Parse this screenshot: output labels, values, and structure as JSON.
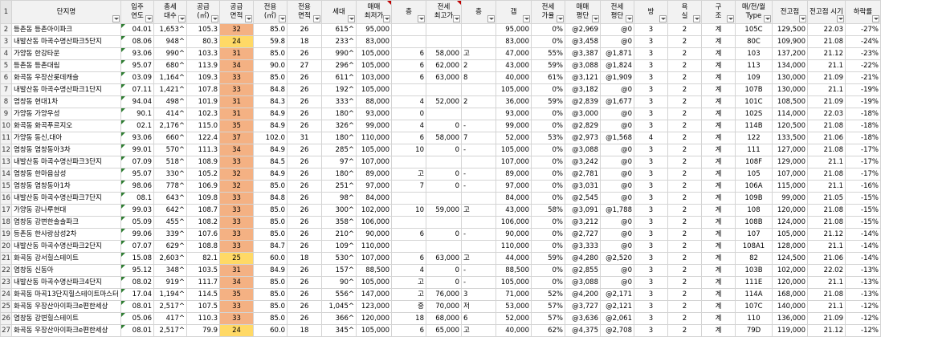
{
  "row_numbers": [
    "1",
    "2",
    "3",
    "4",
    "5",
    "6",
    "7",
    "8",
    "9",
    "10",
    "11",
    "12",
    "13",
    "14",
    "15",
    "16",
    "17",
    "18",
    "19",
    "20",
    "21",
    "22",
    "23",
    "24",
    "25",
    "26",
    "27"
  ],
  "headers": [
    "단지명",
    "입주\n연도",
    "총세\n대수",
    "공급\n(㎡)",
    "공급\n면적",
    "전용\n(㎡)",
    "전용\n면적",
    "세대",
    "매매\n최저가",
    "층",
    "전세\n최고가",
    "층",
    "갭",
    "전세\n가율",
    "매매\n평단",
    "전세\n평단",
    "방",
    "욕\n실",
    "구\n조",
    "매/전/월\nType",
    "전고점",
    "전고점 시기",
    "하락률"
  ],
  "rows": [
    [
      "등촌동 등촌아이파크",
      "04.01",
      "1,653^",
      "105.3",
      "32",
      "85.0",
      "26",
      "615^",
      "95,000",
      "",
      "",
      "",
      "95,000",
      "0%",
      "@2,969",
      "@0",
      "3",
      "2",
      "계",
      "105C",
      "129,500",
      "22.03",
      "-27%"
    ],
    [
      "내발산동 마곡수명산파크5단지",
      "08.06",
      "948^",
      "80.3",
      "24",
      "59.8",
      "18",
      "233^",
      "83,000",
      "",
      "",
      "",
      "83,000",
      "0%",
      "@3,458",
      "@0",
      "3",
      "2",
      "계",
      "80C",
      "109,900",
      "21.08",
      "-24%"
    ],
    [
      "가양동 한강타운",
      "93.06",
      "990^",
      "103.3",
      "31",
      "85.0",
      "26",
      "990^",
      "105,000",
      "6",
      "58,000",
      "고",
      "47,000",
      "55%",
      "@3,387",
      "@1,871",
      "3",
      "2",
      "계",
      "103",
      "137,200",
      "21.12",
      "-23%"
    ],
    [
      "등촌동 등촌대림",
      "95.07",
      "680^",
      "113.9",
      "34",
      "90.0",
      "27",
      "296^",
      "105,000",
      "6",
      "62,000",
      "2",
      "43,000",
      "59%",
      "@3,088",
      "@1,824",
      "3",
      "2",
      "계",
      "113",
      "134,000",
      "21.1",
      "-22%"
    ],
    [
      "화곡동 우장산롯데캐슬",
      "03.09",
      "1,164^",
      "109.3",
      "33",
      "85.0",
      "26",
      "611^",
      "103,000",
      "6",
      "63,000",
      "8",
      "40,000",
      "61%",
      "@3,121",
      "@1,909",
      "3",
      "2",
      "계",
      "109",
      "130,000",
      "21.09",
      "-21%"
    ],
    [
      "내발산동 마곡수명산파크1단지",
      "07.11",
      "1,421^",
      "107.8",
      "33",
      "84.8",
      "26",
      "192^",
      "105,000",
      "",
      "",
      "",
      "105,000",
      "0%",
      "@3,182",
      "@0",
      "3",
      "2",
      "계",
      "107B",
      "130,000",
      "21.1",
      "-19%"
    ],
    [
      "염창동 현대1차",
      "94.04",
      "498^",
      "101.9",
      "31",
      "84.3",
      "26",
      "333^",
      "88,000",
      "4",
      "52,000",
      "2",
      "36,000",
      "59%",
      "@2,839",
      "@1,677",
      "3",
      "2",
      "계",
      "101C",
      "108,500",
      "21.09",
      "-19%"
    ],
    [
      "가양동 가양우성",
      "90.1",
      "414^",
      "102.3",
      "31",
      "84.9",
      "26",
      "180^",
      "93,000",
      "0",
      "",
      "",
      "93,000",
      "0%",
      "@3,000",
      "@0",
      "3",
      "2",
      "계",
      "102S",
      "114,000",
      "22.03",
      "-18%"
    ],
    [
      "화곡동 화곡푸르지오",
      "02.1",
      "2,176^",
      "115.0",
      "35",
      "84.9",
      "26",
      "326^",
      "99,000",
      "4",
      "0",
      "-",
      "99,000",
      "0%",
      "@2,829",
      "@0",
      "3",
      "2",
      "계",
      "114B",
      "120,500",
      "21.08",
      "-18%"
    ],
    [
      "가양동 동신,대아",
      "93.06",
      "660^",
      "122.4",
      "37",
      "102.0",
      "31",
      "180^",
      "110,000",
      "6",
      "58,000",
      "7",
      "52,000",
      "53%",
      "@2,973",
      "@1,568",
      "4",
      "2",
      "계",
      "122",
      "133,500",
      "21.06",
      "-18%"
    ],
    [
      "염창동 염창동아3차",
      "99.01",
      "570^",
      "111.3",
      "34",
      "84.9",
      "26",
      "285^",
      "105,000",
      "10",
      "0",
      "-",
      "105,000",
      "0%",
      "@3,088",
      "@0",
      "3",
      "2",
      "계",
      "111",
      "127,000",
      "21.08",
      "-17%"
    ],
    [
      "내발산동 마곡수명산파크3단지",
      "07.09",
      "518^",
      "108.9",
      "33",
      "84.5",
      "26",
      "97^",
      "107,000",
      "",
      "",
      "",
      "107,000",
      "0%",
      "@3,242",
      "@0",
      "3",
      "2",
      "계",
      "108F",
      "129,000",
      "21.1",
      "-17%"
    ],
    [
      "염창동 한마음삼성",
      "95.07",
      "330^",
      "105.2",
      "32",
      "84.9",
      "26",
      "180^",
      "89,000",
      "고",
      "0",
      "-",
      "89,000",
      "0%",
      "@2,781",
      "@0",
      "3",
      "2",
      "계",
      "105",
      "107,000",
      "21.08",
      "-17%"
    ],
    [
      "염창동 염창동아1차",
      "98.06",
      "778^",
      "106.9",
      "32",
      "85.0",
      "26",
      "251^",
      "97,000",
      "7",
      "0",
      "-",
      "97,000",
      "0%",
      "@3,031",
      "@0",
      "3",
      "2",
      "계",
      "106A",
      "115,000",
      "21.1",
      "-16%"
    ],
    [
      "내발산동 마곡수명산파크7단지",
      "08.1",
      "643^",
      "109.8",
      "33",
      "84.8",
      "26",
      "98^",
      "84,000",
      "",
      "",
      "",
      "84,000",
      "0%",
      "@2,545",
      "@0",
      "3",
      "2",
      "계",
      "109B",
      "99,000",
      "21.05",
      "-15%"
    ],
    [
      "가양동 강나루현대",
      "99.03",
      "642^",
      "108.7",
      "33",
      "85.0",
      "26",
      "300^",
      "102,000",
      "10",
      "59,000",
      "고",
      "43,000",
      "58%",
      "@3,091",
      "@1,788",
      "3",
      "2",
      "계",
      "108",
      "120,000",
      "21.08",
      "-15%"
    ],
    [
      "염창동 강변한솔솔파크",
      "05.09",
      "455^",
      "108.2",
      "33",
      "85.0",
      "26",
      "358^",
      "106,000",
      "",
      "",
      "",
      "106,000",
      "0%",
      "@3,212",
      "@0",
      "3",
      "2",
      "계",
      "108B",
      "124,000",
      "21.08",
      "-15%"
    ],
    [
      "등촌동 한사랑삼성2차",
      "99.06",
      "339^",
      "107.6",
      "33",
      "85.0",
      "26",
      "210^",
      "90,000",
      "6",
      "0",
      "-",
      "90,000",
      "0%",
      "@2,727",
      "@0",
      "3",
      "2",
      "계",
      "107",
      "105,000",
      "21.12",
      "-14%"
    ],
    [
      "내발산동 마곡수명산파크2단지",
      "07.07",
      "629^",
      "108.8",
      "33",
      "84.7",
      "26",
      "109^",
      "110,000",
      "",
      "",
      "",
      "110,000",
      "0%",
      "@3,333",
      "@0",
      "3",
      "2",
      "계",
      "108A1",
      "128,000",
      "21.1",
      "-14%"
    ],
    [
      "화곡동 강서힐스테이트",
      "15.08",
      "2,603^",
      "82.1",
      "25",
      "60.0",
      "18",
      "530^",
      "107,000",
      "6",
      "63,000",
      "고",
      "44,000",
      "59%",
      "@4,280",
      "@2,520",
      "3",
      "2",
      "계",
      "82",
      "124,500",
      "21.06",
      "-14%"
    ],
    [
      "염창동 신동아",
      "95.12",
      "348^",
      "103.5",
      "31",
      "84.9",
      "26",
      "157^",
      "88,500",
      "4",
      "0",
      "-",
      "88,500",
      "0%",
      "@2,855",
      "@0",
      "3",
      "2",
      "계",
      "103B",
      "102,000",
      "22.02",
      "-13%"
    ],
    [
      "내발산동 마곡수명산파크4단지",
      "08.02",
      "919^",
      "111.7",
      "34",
      "85.0",
      "26",
      "90^",
      "105,000",
      "고",
      "0",
      "-",
      "105,000",
      "0%",
      "@3,088",
      "@0",
      "3",
      "2",
      "계",
      "111E",
      "120,000",
      "21.1",
      "-13%"
    ],
    [
      "화곡동 마곡13단지힐스테이트마스터",
      "17.04",
      "1,194^",
      "114.5",
      "35",
      "85.0",
      "26",
      "556^",
      "147,000",
      "고",
      "76,000",
      "3",
      "71,000",
      "52%",
      "@4,200",
      "@2,171",
      "3",
      "2",
      "계",
      "114A",
      "168,000",
      "21.08",
      "-13%"
    ],
    [
      "화곡동 우장산아이파크e편한세상",
      "08.01",
      "2,517^",
      "107.5",
      "33",
      "85.0",
      "26",
      "1,045^",
      "123,000",
      "중",
      "70,000",
      "저",
      "53,000",
      "57%",
      "@3,727",
      "@2,121",
      "3",
      "2",
      "계",
      "107C",
      "140,000",
      "21.1",
      "-12%"
    ],
    [
      "염창동 강변힐스테이트",
      "05.06",
      "417^",
      "110.3",
      "33",
      "85.0",
      "26",
      "366^",
      "120,000",
      "18",
      "68,000",
      "6",
      "52,000",
      "57%",
      "@3,636",
      "@2,061",
      "3",
      "2",
      "계",
      "110",
      "136,000",
      "21.09",
      "-12%"
    ],
    [
      "화곡동 우장산아이파크e편한세상",
      "08.01",
      "2,517^",
      "79.9",
      "24",
      "60.0",
      "18",
      "345^",
      "105,000",
      "6",
      "65,000",
      "고",
      "40,000",
      "62%",
      "@4,375",
      "@2,708",
      "3",
      "2",
      "계",
      "79D",
      "119,000",
      "21.12",
      "-12%"
    ]
  ],
  "colors": {
    "area_fill": "#f4b183",
    "area_fill_small": "#ffd966",
    "pink_header": "#f8cbad"
  }
}
